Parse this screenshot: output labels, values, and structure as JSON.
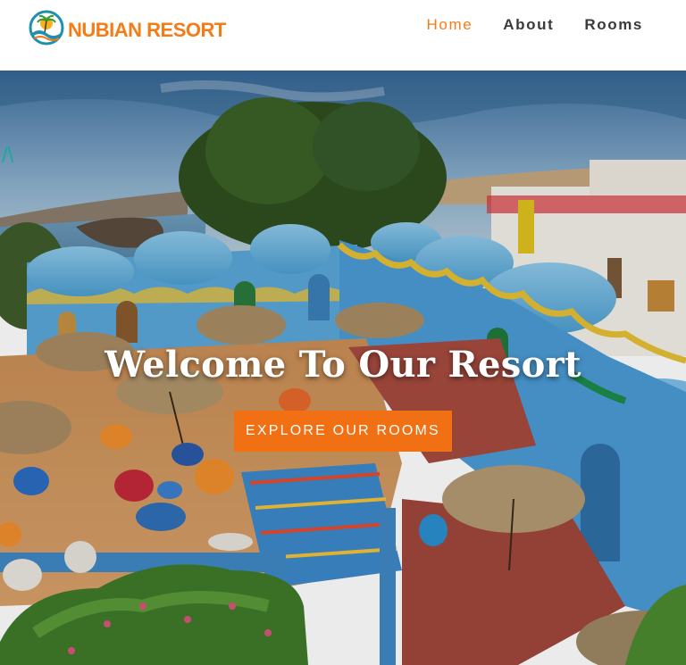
{
  "brand": {
    "name": "NUBIAN RESORT",
    "logo_icon": "sun-palm-wave-logo-icon",
    "color": "#f47b16"
  },
  "nav": {
    "items": [
      {
        "label": "Home",
        "active": true
      },
      {
        "label": "About",
        "active": false
      },
      {
        "label": "Rooms",
        "active": false
      }
    ],
    "active_color": "#f47b16",
    "text_color": "#3a3a3a"
  },
  "hero": {
    "heading": "Welcome To Our Resort",
    "cta_label": "EXPLORE OUR ROOMS",
    "cta_color": "#f27014",
    "edge_mark": "/\\"
  }
}
